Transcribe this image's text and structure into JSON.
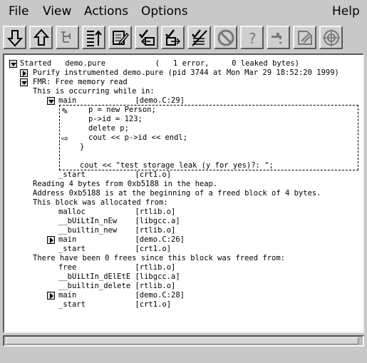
{
  "menu": {
    "file": "File",
    "view": "View",
    "actions": "Actions",
    "options": "Options",
    "help": "Help"
  },
  "toolbar": {
    "icons": [
      "expand-down-icon",
      "collapse-up-icon",
      "tree-icon",
      "sort-icon",
      "edit-icon",
      "suppress-check-icon",
      "check-export-icon",
      "unsuppress-icon",
      "stop-icon",
      "question-icon",
      "faucet-icon",
      "snapshot-icon",
      "target-icon"
    ]
  },
  "log": {
    "l0": "Started   demo.pure           (   1 error,     0 leaked bytes)",
    "l1": "Purify instrumented demo.pure (pid 3744 at Mon Mar 29 18:52:20 1999)",
    "l2": "FMR: Free memory read",
    "l3": "This is occurring while in:",
    "l4": "main             [demo.C:29]",
    "s1": "p = new Person;",
    "s2": "p->id = 123;",
    "s3": "delete p;",
    "s4": "cout << p->id << endl;",
    "s5": "}",
    "s6": "cout << \"test storage leak (y for yes)?: \";",
    "l5": "_start           [crt1.o]",
    "l6": "Reading 4 bytes from 0xb5188 in the heap.",
    "l7": "Address 0xb5188 is at the beginning of a freed block of 4 bytes.",
    "l8": "This block was allocated from:",
    "l9": "malloc           [rtlib.o]",
    "l10": "__bUiLtIn_nEw    [libgcc.a]",
    "l11": "__builtin_new    [rtlib.o]",
    "l12": "main             [demo.C:26]",
    "l13": "_start           [crt1.o]",
    "l14": "There have been 0 frees since this block was freed from:",
    "l15": "free             [rtlib.o]",
    "l16": "__bUiLtIn_dElEtE [libgcc.a]",
    "l17": "__builtin_delete [rtlib.o]",
    "l18": "main             [demo.C:28]",
    "l19": "_start           [crt1.o]"
  }
}
